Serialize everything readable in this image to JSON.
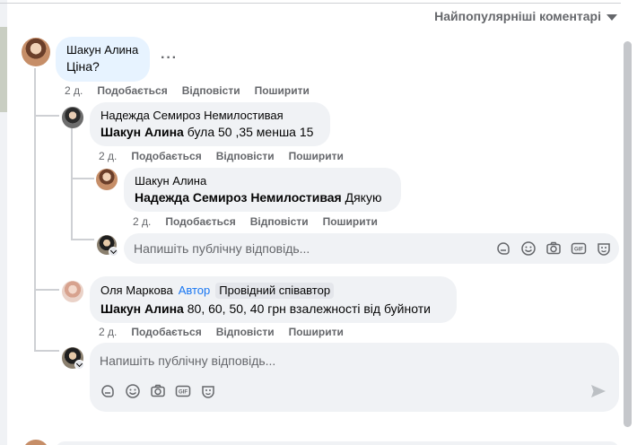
{
  "sort": {
    "label": "Найпопулярніші коментарі"
  },
  "comments": [
    {
      "author": "Шакун Алина",
      "text": "Ціна?",
      "time": "2 д.",
      "like": "Подобається",
      "reply": "Відповісти",
      "share": "Поширити",
      "more": "···",
      "replies": [
        {
          "author": "Надежда Семироз Немилостивая",
          "mention": "Шакун Алина",
          "text": " була 50 ,35 менша 15",
          "time": "2 д.",
          "like": "Подобається",
          "reply": "Відповісти",
          "share": "Поширити",
          "replies": [
            {
              "author": "Шакун Алина",
              "mention": "Надежда Семироз Немилостивая",
              "text": " Дякую",
              "time": "2 д.",
              "like": "Подобається",
              "reply": "Відповісти",
              "share": "Поширити"
            }
          ],
          "reply_placeholder": "Напишіть публічну відповідь..."
        },
        {
          "author": "Оля Маркова",
          "author_badge": "Автор",
          "role_badge": "Провідний співавтор",
          "mention": "Шакун Алина",
          "text": " 80, 60, 50, 40 грн взалежності від буйноти",
          "time": "2 д.",
          "like": "Подобається",
          "reply": "Відповісти",
          "share": "Поширити"
        }
      ],
      "reply_placeholder": "Напишіть публічну відповідь..."
    }
  ],
  "icons": [
    "sticker-icon",
    "emoji-icon",
    "camera-icon",
    "gif-icon",
    "avatar-sticker-icon",
    "send-icon"
  ]
}
